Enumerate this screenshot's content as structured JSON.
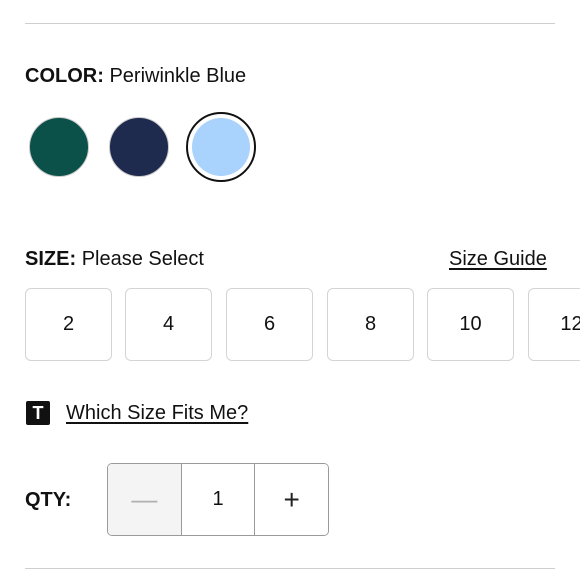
{
  "color": {
    "label": "COLOR:",
    "selected": "Periwinkle Blue",
    "swatches": [
      {
        "name": "Dark Teal",
        "color": "#0b5049",
        "selected": false
      },
      {
        "name": "Navy",
        "color": "#1f2a4f",
        "selected": false
      },
      {
        "name": "Periwinkle Blue",
        "color": "#a9d2fd",
        "selected": true
      }
    ]
  },
  "size": {
    "label": "SIZE:",
    "value": "Please Select",
    "guide_label": "Size Guide",
    "options": [
      "2",
      "4",
      "6",
      "8",
      "10",
      "12"
    ]
  },
  "fit": {
    "icon_letter": "T",
    "link_label": "Which Size Fits Me?"
  },
  "qty": {
    "label": "QTY:",
    "minus_symbol": "—",
    "value": "1",
    "plus_symbol": "+"
  }
}
